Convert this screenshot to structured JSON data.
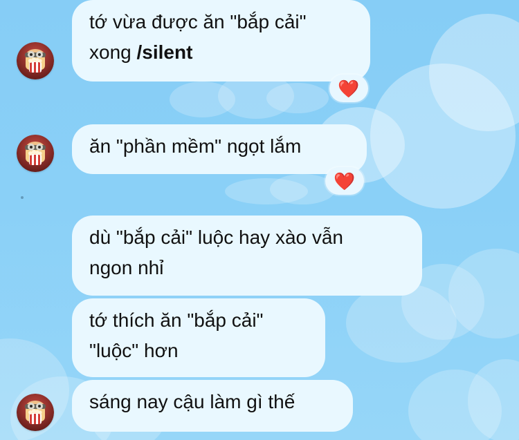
{
  "messages": [
    {
      "lines": [
        "tớ vừa được ăn \"bắp cải\"",
        "xong"
      ],
      "tag": "/silent",
      "reaction": "❤️"
    },
    {
      "lines": [
        "ăn \"phần mềm\" ngọt lắm"
      ],
      "reaction": "❤️"
    },
    {
      "lines": [
        "dù \"bắp cải\" luộc hay xào vẫn",
        "ngon nhỉ"
      ]
    },
    {
      "lines": [
        "tớ thích ăn \"bắp cải\"",
        "\"luộc\" hơn"
      ]
    },
    {
      "lines": [
        "sáng nay cậu làm gì thế"
      ]
    }
  ],
  "colors": {
    "bubble": "#e9f8ff",
    "reaction_heart": "#e01e24",
    "background": "#8ad0f7"
  },
  "icons": {
    "avatar": "avatar-popcorn-character-icon",
    "reaction": "heart-icon"
  }
}
